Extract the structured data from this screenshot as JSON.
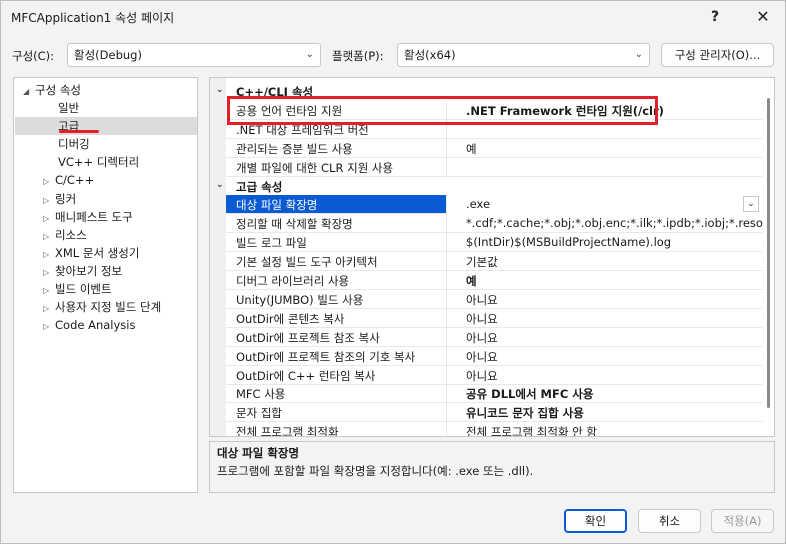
{
  "window": {
    "title": "MFCApplication1 속성 페이지",
    "help_glyph": "?",
    "close_glyph": "✕"
  },
  "config": {
    "config_label": "구성(C):",
    "config_value": "활성(Debug)",
    "platform_label": "플랫폼(P):",
    "platform_value": "활성(x64)",
    "manager_button": "구성 관리자(O)..."
  },
  "tree": {
    "root": "구성 속성",
    "items": [
      {
        "label": "일반",
        "expandable": false
      },
      {
        "label": "고급",
        "expandable": false,
        "selected": true
      },
      {
        "label": "디버깅",
        "expandable": false
      },
      {
        "label": "VC++ 디렉터리",
        "expandable": false
      },
      {
        "label": "C/C++",
        "expandable": true
      },
      {
        "label": "링커",
        "expandable": true
      },
      {
        "label": "매니페스트 도구",
        "expandable": true
      },
      {
        "label": "리소스",
        "expandable": true
      },
      {
        "label": "XML 문서 생성기",
        "expandable": true
      },
      {
        "label": "찾아보기 정보",
        "expandable": true
      },
      {
        "label": "빌드 이벤트",
        "expandable": true
      },
      {
        "label": "사용자 지정 빌드 단계",
        "expandable": true
      },
      {
        "label": "Code Analysis",
        "expandable": true
      }
    ]
  },
  "grid": {
    "sections": [
      {
        "title": "C++/CLI 속성",
        "rows": [
          {
            "name": "공용 언어 런타임 지원",
            "value": ".NET Framework 런타임 지원(/clr)",
            "bold": true
          },
          {
            "name": ".NET 대상 프레임워크 버전",
            "value": "",
            "bold": false
          },
          {
            "name": "관리되는 증분 빌드 사용",
            "value": "예",
            "bold": false
          },
          {
            "name": "개별 파일에 대한 CLR 지원 사용",
            "value": "",
            "bold": false
          }
        ]
      },
      {
        "title": "고급 속성",
        "rows": [
          {
            "name": "대상 파일 확장명",
            "value": ".exe",
            "bold": false,
            "selected": true
          },
          {
            "name": "정리할 때 삭제할 확장명",
            "value": "*.cdf;*.cache;*.obj;*.obj.enc;*.ilk;*.ipdb;*.iobj;*.resources;*.tlb;*.tli;*.tlh;*.tmp",
            "bold": false
          },
          {
            "name": "빌드 로그 파일",
            "value": "$(IntDir)$(MSBuildProjectName).log",
            "bold": false
          },
          {
            "name": "기본 설정 빌드 도구 아키텍처",
            "value": "기본값",
            "bold": false
          },
          {
            "name": "디버그 라이브러리 사용",
            "value": "예",
            "bold": true
          },
          {
            "name": "Unity(JUMBO) 빌드 사용",
            "value": "아니요",
            "bold": false
          },
          {
            "name": "OutDir에 콘텐츠 복사",
            "value": "아니요",
            "bold": false
          },
          {
            "name": "OutDir에 프로젝트 참조 복사",
            "value": "아니요",
            "bold": false
          },
          {
            "name": "OutDir에 프로젝트 참조의 기호 복사",
            "value": "아니요",
            "bold": false
          },
          {
            "name": "OutDir에 C++ 런타임 복사",
            "value": "아니요",
            "bold": false
          },
          {
            "name": "MFC 사용",
            "value": "공유 DLL에서 MFC 사용",
            "bold": true
          },
          {
            "name": "문자 집합",
            "value": "유니코드 문자 집합 사용",
            "bold": true
          },
          {
            "name": "전체 프로그램 최적화",
            "value": "전체 프로그램 최적화 안 함",
            "bold": false
          }
        ]
      }
    ]
  },
  "description": {
    "title": "대상 파일 확장명",
    "text": "프로그램에 포함할 파일 확장명을 지정합니다(예: .exe 또는 .dll)."
  },
  "footer": {
    "ok": "확인",
    "cancel": "취소",
    "apply": "적용(A)"
  },
  "colors": {
    "accent": "#0a5ad4",
    "highlight_red": "#e0212b",
    "selection_gray": "#dcdcdc"
  }
}
